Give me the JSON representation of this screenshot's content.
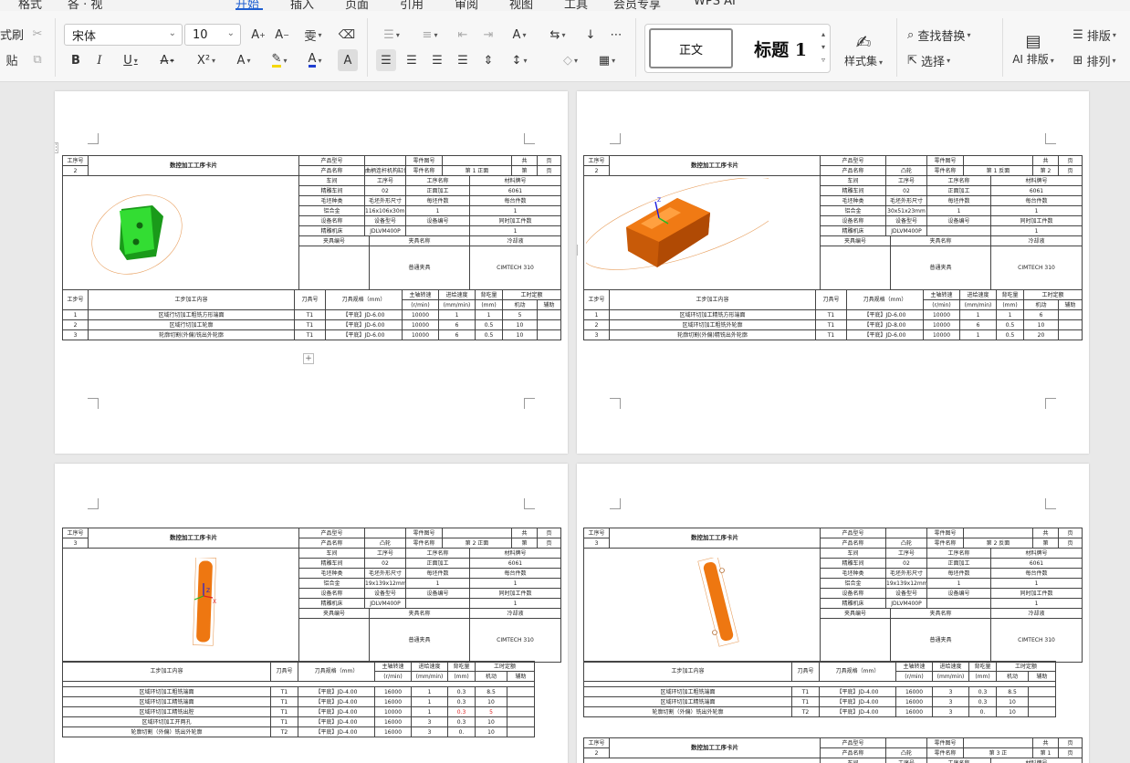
{
  "tabs": [
    {
      "label": "格式",
      "active": false
    },
    {
      "label": "各 · 视",
      "active": false
    },
    {
      "label": "开始",
      "active": true
    },
    {
      "label": "插入",
      "active": false
    },
    {
      "label": "页面",
      "active": false
    },
    {
      "label": "引用",
      "active": false
    },
    {
      "label": "审阅",
      "active": false
    },
    {
      "label": "视图",
      "active": false
    },
    {
      "label": "工具",
      "active": false
    },
    {
      "label": "会员专享",
      "active": false
    },
    {
      "label": "WPS AI",
      "active": false
    }
  ],
  "ribbon": {
    "format_brush": "式刷",
    "paste": "贴",
    "font_name": "宋体",
    "font_size": "10",
    "style_normal": "正文",
    "style_heading": "标题 1",
    "style_set": "样式集",
    "find_replace": "查找替换",
    "select": "选择",
    "ai_layout": "AI 排版",
    "layout": "排版",
    "arrange": "排列",
    "colors": {
      "highlight": "#f5d800",
      "font_color": "#1f3fd1",
      "accent": "#1f5fd1"
    }
  },
  "common": {
    "process_no": "工序号",
    "card_title": "数控加工工序卡片",
    "product_model": "产品型号",
    "part_drawing_no": "零件图号",
    "total": "共",
    "page_unit": "页",
    "product_name": "产品名称",
    "part_name": "零件名称",
    "page_no": "第",
    "workshop": "车间",
    "process_name": "工序名称",
    "material_no": "材料牌号",
    "workshop_val": "精雕车间",
    "blank_type": "毛坯种类",
    "blank_size": "毛坯外形尺寸",
    "per_blank": "每坯件数",
    "per_unit": "每台件数",
    "alloy": "铝合金",
    "equip_name": "设备名称",
    "equip_model": "设备型号",
    "equip_no": "设备编号",
    "concurrent": "同时加工件数",
    "equip_val": "精雕机床",
    "equip_model_val": "JDLVM400P",
    "fixture_no": "夹具编号",
    "fixture_name": "夹具名称",
    "coolant": "冷却液",
    "fixture_val": "普通夹具",
    "coolant_val": "CIMTECH 310",
    "step_no": "工步号",
    "step_content": "工步加工内容",
    "tool_no": "刀具号",
    "tool_spec": "刀具规格（mm）",
    "spindle": "主轴转速",
    "spindle_unit": "(r/min)",
    "feed": "进给速度",
    "feed_unit": "(mm/min)",
    "depth": "背吃量",
    "depth_unit": "(mm)",
    "time_quota": "工时定额",
    "machine": "机动",
    "aux": "辅助"
  },
  "cards": [
    {
      "process_no": "2",
      "product_name": "曲柄连杆机构缸体",
      "side": "第 1 正面",
      "process_no2": "02",
      "process_name": "正面加工",
      "material": "6061",
      "blank_size": "116x106x30mm",
      "per_blank": "1",
      "per_unit": "1",
      "concurrent": "1",
      "model_color": "#22cc22",
      "steps": [
        {
          "no": "1",
          "content": "区域行切加工粗铣方形端面",
          "tool": "T1",
          "spec": "【平底】JD-6.00",
          "rpm": "10000",
          "feed": "1",
          "depth": "1",
          "time": "5",
          "aux": ""
        },
        {
          "no": "2",
          "content": "区域行切加工轮廓",
          "tool": "T1",
          "spec": "【平底】JD-6.00",
          "rpm": "10000",
          "feed": "6",
          "depth": "0.5",
          "time": "10",
          "aux": ""
        },
        {
          "no": "3",
          "content": "轮廓切割(外偏)铣出外轮廓",
          "tool": "T1",
          "spec": "【平底】JD-6.00",
          "rpm": "10000",
          "feed": "6",
          "depth": "0.5",
          "time": "10",
          "aux": ""
        }
      ]
    },
    {
      "process_no": "2",
      "product_name": "凸轮",
      "side": "第 1 反面",
      "page": "2",
      "process_no2": "02",
      "process_name": "正面加工",
      "material": "6061",
      "blank_size": "30x51x23mm",
      "per_blank": "1",
      "per_unit": "1",
      "concurrent": "1",
      "model_color": "#ee7711",
      "steps": [
        {
          "no": "1",
          "content": "区域环切加工精铣方形端面",
          "tool": "T1",
          "spec": "【平底】JD-6.00",
          "rpm": "10000",
          "feed": "1",
          "depth": "1",
          "time": "6",
          "aux": ""
        },
        {
          "no": "2",
          "content": "区域环切加工粗铣外轮廓",
          "tool": "T1",
          "spec": "【平底】JD-8.00",
          "rpm": "10000",
          "feed": "6",
          "depth": "0.5",
          "time": "10",
          "aux": ""
        },
        {
          "no": "3",
          "content": "轮廓切割(外偏)精铣出外轮廓",
          "tool": "T1",
          "spec": "【平底】JD-6.00",
          "rpm": "10000",
          "feed": "1",
          "depth": "0.5",
          "time": "20",
          "aux": ""
        }
      ]
    },
    {
      "process_no": "3",
      "product_name": "凸轮",
      "side": "第 2 正面",
      "process_no2": "02",
      "process_name": "正面加工",
      "material": "6061",
      "blank_size": "19x139x12mm",
      "per_blank": "1",
      "per_unit": "1",
      "concurrent": "1",
      "model_color": "#ee7711",
      "steps": [
        {
          "content": "区域环切加工粗铣端面",
          "tool": "T1",
          "spec": "【平底】JD-4.00",
          "rpm": "16000",
          "feed": "1",
          "depth": "0.3",
          "time": "8.5",
          "aux": "",
          "red": false
        },
        {
          "content": "区域环切加工精铣端面",
          "tool": "T1",
          "spec": "【平底】JD-4.00",
          "rpm": "16000",
          "feed": "1",
          "depth": "0.3",
          "time": "10",
          "aux": "",
          "red": false
        },
        {
          "content": "区域环切加工精铣出腔",
          "tool": "T1",
          "spec": "【平底】JD-4.00",
          "rpm": "10000",
          "feed": "1",
          "depth": "0.3",
          "time": "5",
          "aux": "",
          "red": true
        },
        {
          "content": "区域环切加工开两孔",
          "tool": "T1",
          "spec": "【平底】JD-4.00",
          "rpm": "16000",
          "feed": "3",
          "depth": "0.3",
          "time": "10",
          "aux": "",
          "red": false
        },
        {
          "content": "轮廓切割（外偏）铣出外轮廓",
          "tool": "T2",
          "spec": "【平底】JD-4.00",
          "rpm": "16000",
          "feed": "3",
          "depth": "0.",
          "time": "10",
          "aux": "",
          "red": false
        }
      ]
    },
    {
      "process_no": "3",
      "product_name": "凸轮",
      "side": "第 2 反面",
      "process_no2": "02",
      "process_name": "正面加工",
      "material": "6061",
      "blank_size": "19x139x12mm",
      "per_blank": "1",
      "per_unit": "1",
      "concurrent": "1",
      "model_color": "#ee7711",
      "steps": [
        {
          "content": "区域环切加工粗铣端面",
          "tool": "T1",
          "spec": "【平底】JD-4.00",
          "rpm": "16000",
          "feed": "3",
          "depth": "0.3",
          "time": "8.5",
          "aux": ""
        },
        {
          "content": "区域环切加工精铣端面",
          "tool": "T1",
          "spec": "【平底】JD-4.00",
          "rpm": "16000",
          "feed": "3",
          "depth": "0.3",
          "time": "10",
          "aux": ""
        },
        {
          "content": "轮廓切割（外偏）铣出外轮廓",
          "tool": "T2",
          "spec": "【平底】JD-4.00",
          "rpm": "16000",
          "feed": "3",
          "depth": "0.",
          "time": "10",
          "aux": ""
        }
      ]
    },
    {
      "process_no": "2",
      "product_name": "凸轮",
      "side": "第 3 正",
      "page": "1"
    }
  ]
}
